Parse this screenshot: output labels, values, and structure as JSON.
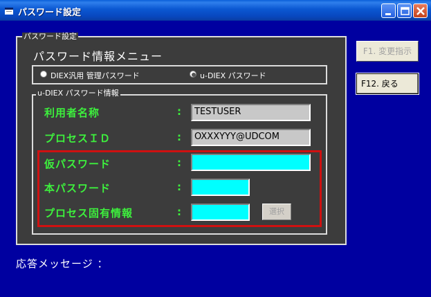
{
  "window": {
    "title": "パスワード設定",
    "minimize_glyph": "_",
    "maximize_glyph": "□",
    "close_glyph": "×"
  },
  "main_group": {
    "caption": "パスワード設定",
    "menu_title": "パスワード情報メニュー"
  },
  "radio_options": [
    {
      "label": "DIEX汎用 管理パスワード",
      "checked": false
    },
    {
      "label": "u-DIEX パスワード",
      "checked": true
    }
  ],
  "udiex_group": {
    "caption": "u-DIEX パスワード情報"
  },
  "fields": {
    "user_name": {
      "label": "利用者名称",
      "colon": ":",
      "value": "TESTUSER"
    },
    "process_id": {
      "label": "プロセスＩＤ",
      "colon": ":",
      "value": "OXXXYYY@UDCOM"
    },
    "temp_password": {
      "label": "仮パスワード",
      "colon": ":",
      "value": ""
    },
    "real_password": {
      "label": "本パスワード",
      "colon": ":",
      "value": ""
    },
    "process_info": {
      "label": "プロセス固有情報",
      "colon": ":",
      "value": ""
    }
  },
  "buttons": {
    "select": "選択",
    "f1": "F1. 変更指示",
    "f12": "F12. 戻る"
  },
  "response": {
    "label": "応答メッセージ ："
  },
  "colors": {
    "background": "#0000a0",
    "label_green": "#3df03d",
    "input_cyan": "#00ffff",
    "highlight_red": "#d01010"
  }
}
